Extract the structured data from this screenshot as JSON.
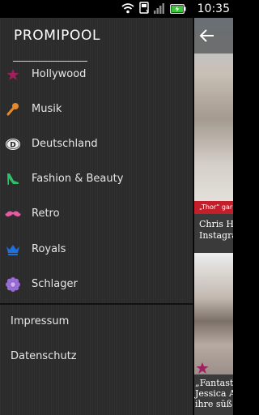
{
  "statusbar": {
    "time": "10:35",
    "icons": [
      "wifi-icon",
      "storage-icon",
      "signal-icon",
      "battery-charging-icon"
    ]
  },
  "drawer": {
    "logo": "PROMIPOOL",
    "items": [
      {
        "label": "Hollywood",
        "icon": "star-icon",
        "color": "#a0205e"
      },
      {
        "label": "Musik",
        "icon": "microphone-icon",
        "color": "#e6892a"
      },
      {
        "label": "Deutschland",
        "icon": "d-badge-icon",
        "color": "#f0f0f0"
      },
      {
        "label": "Fashion & Beauty",
        "icon": "high-heel-icon",
        "color": "#2fbf6a"
      },
      {
        "label": "Retro",
        "icon": "mustache-icon",
        "color": "#e55aa0"
      },
      {
        "label": "Royals",
        "icon": "crown-icon",
        "color": "#1e6fe0"
      },
      {
        "label": "Schlager",
        "icon": "flower-icon",
        "color": "#9a6ad8"
      }
    ],
    "footer": [
      {
        "label": "Impressum"
      },
      {
        "label": "Datenschutz"
      }
    ]
  },
  "content": {
    "card1": {
      "tag": "„Thor“ gar",
      "caption_lines": [
        "Chris H",
        "Instagra"
      ]
    },
    "card2": {
      "caption_lines": [
        "„Fantasti",
        "Jessica A",
        "ihre süß"
      ]
    }
  }
}
